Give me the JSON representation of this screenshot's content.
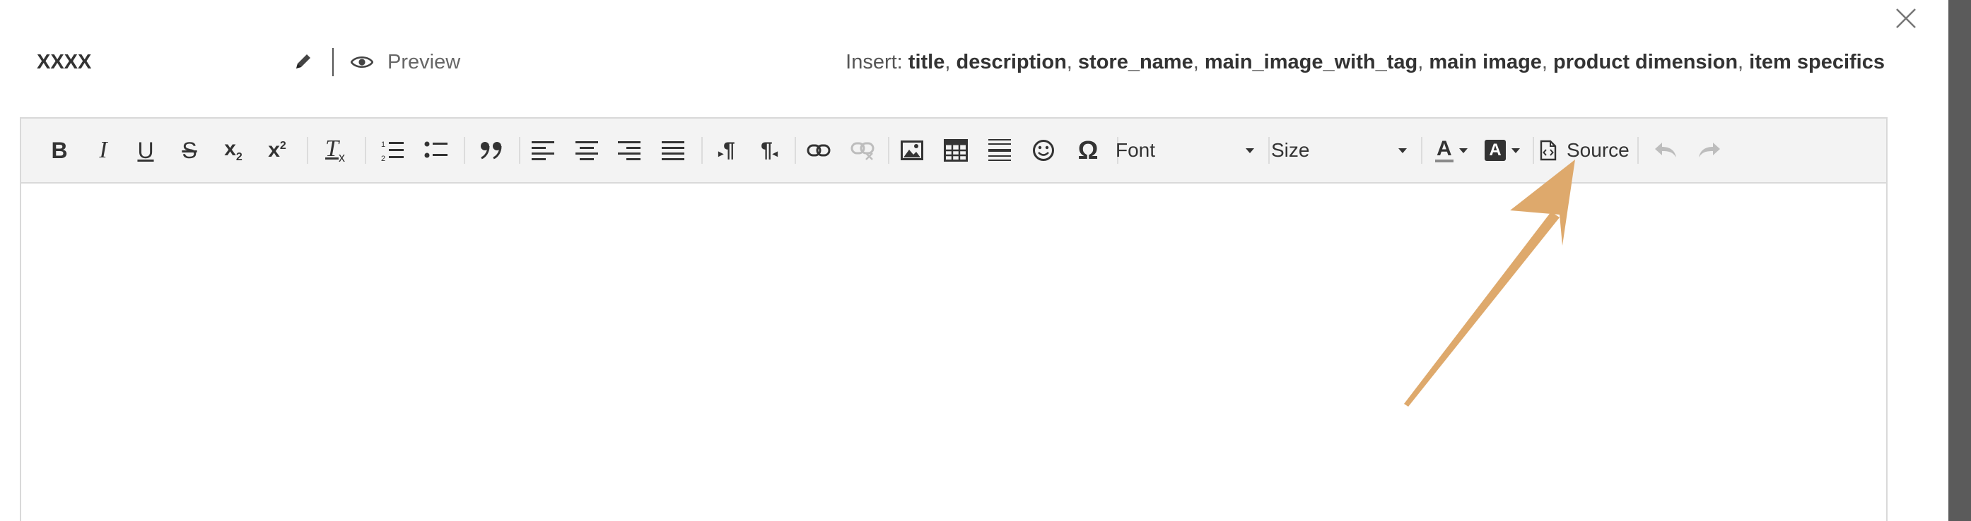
{
  "header": {
    "template_name": "XXXX",
    "preview_label": "Preview",
    "insert_label": "Insert:",
    "insert_tokens": [
      "title",
      "description",
      "store_name",
      "main_image_with_tag",
      "main image",
      "product dimension",
      "item specifics"
    ]
  },
  "toolbar": {
    "font_label": "Font",
    "size_label": "Size",
    "source_label": "Source",
    "buttons": {
      "bold": "B",
      "italic": "I",
      "underline": "U",
      "strike": "S",
      "subscript": "x",
      "subscript_mark": "2",
      "superscript": "x",
      "superscript_mark": "2",
      "remove_format": "T",
      "remove_format_mark": "x",
      "ltr": "¶",
      "rtl": "¶",
      "special_char": "Ω",
      "text_color": "A",
      "bg_color": "A"
    }
  },
  "colors": {
    "toolbar_bg": "#f3f3f3",
    "border": "#d9d9d9",
    "annotation_arrow": "#dea96c",
    "scrollbar": "#5b5b5b"
  }
}
